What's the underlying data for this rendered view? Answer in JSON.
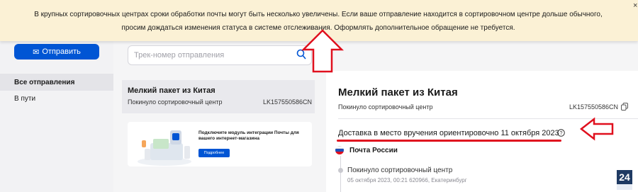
{
  "banner": {
    "line1": "В крупных сортировочных центрах сроки обработки почты могут быть несколько увеличены. Если ваше отправление находится в сортировочном центре дольше обычного,",
    "line2": "просим дождаться изменения статуса в системе отслеживания. Оформлять дополнительное обращение не требуется.",
    "close_icon": "close-icon"
  },
  "sidebar": {
    "send_label": "Отправить",
    "items": [
      {
        "label": "Все отправления",
        "active": true
      },
      {
        "label": "В пути",
        "active": false
      }
    ]
  },
  "search": {
    "placeholder": "Трек-номер отправления",
    "icon": "search-icon"
  },
  "list": {
    "items": [
      {
        "title": "Мелкий пакет из Китая",
        "status": "Покинуло сортировочный центр",
        "track": "LK157550586CN"
      }
    ]
  },
  "promo": {
    "title": "Подключите модуль интеграции Почты для вашего интернет-магазина",
    "button": "Подробнее"
  },
  "detail": {
    "title": "Мелкий пакет из Китая",
    "status": "Покинуло сортировочный центр",
    "track": "LK157550586CN",
    "delivery": "Доставка в место вручения ориентировочно 11 октября 2023",
    "carrier": "Почта России",
    "events": [
      {
        "title": "Покинуло сортировочный центр",
        "meta": "05 октября 2023, 00:21 620966, Екатеринбург"
      }
    ]
  },
  "watermark": {
    "text": "24"
  },
  "colors": {
    "accent": "#0055d4",
    "annotation": "#e0101e",
    "banner": "#fbf1d5"
  }
}
